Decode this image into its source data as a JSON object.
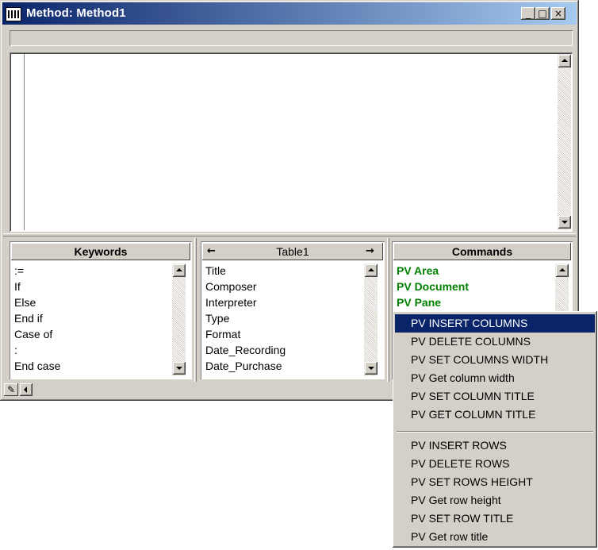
{
  "window": {
    "title": "Method: Method1",
    "minimize_glyph": "_",
    "maximize_glyph": "□",
    "close_glyph": "×"
  },
  "keywords": {
    "header": "Keywords",
    "items": [
      ":=",
      "If",
      "Else",
      "End if",
      "Case of",
      ":",
      "End case"
    ]
  },
  "tables": {
    "header": "Table1",
    "prev_glyph": "←",
    "next_glyph": "→",
    "items": [
      "Title",
      "Composer",
      "Interpreter",
      "Type",
      "Format",
      "Date_Recording",
      "Date_Purchase"
    ]
  },
  "commands": {
    "header": "Commands",
    "items": [
      "PV Area",
      "PV Document",
      "PV Pane"
    ],
    "item_color": "#007f00"
  },
  "context_menu": {
    "group1": [
      "PV INSERT COLUMNS",
      "PV DELETE COLUMNS",
      "PV SET COLUMNS WIDTH",
      "PV Get column width",
      "PV SET COLUMN TITLE",
      "PV GET COLUMN TITLE"
    ],
    "group2": [
      "PV INSERT ROWS",
      "PV DELETE ROWS",
      "PV SET ROWS HEIGHT",
      "PV Get row height",
      "PV SET ROW TITLE",
      "PV Get row title"
    ],
    "selected": "PV INSERT COLUMNS",
    "highlight_color": "#0a246a"
  },
  "icons": {
    "app": "method-editor-icon",
    "pencil": "pencil-icon"
  }
}
